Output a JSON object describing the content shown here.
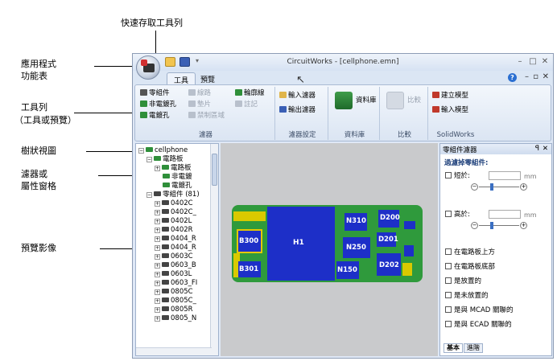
{
  "annotations": {
    "qat": "快速存取工具列",
    "app_menu_line1": "應用程式",
    "app_menu_line2": "功能表",
    "toolbar_line1": "工具列",
    "toolbar_line2": "（工具或預覽）",
    "tree_view": "樹狀視圖",
    "filter_line1": "濾器或",
    "filter_line2": "屬性窗格",
    "preview_image": "預覽影像"
  },
  "window": {
    "title": "CircuitWorks - [cellphone.emn]",
    "controls": [
      "–",
      "□",
      "✕"
    ]
  },
  "tabs": [
    "工具",
    "預覽"
  ],
  "ribbon": {
    "filters": {
      "items": [
        "零組件",
        "非電鍍孔",
        "電鍍孔",
        "線路",
        "墊片",
        "禁制區域",
        "輪廓線",
        "註記"
      ],
      "label": "濾器"
    },
    "filter_settings": {
      "items": [
        "輸入濾器",
        "輸出濾器"
      ],
      "label": "濾器設定"
    },
    "library": {
      "button": "資料庫",
      "label": "資料庫"
    },
    "compare": {
      "button": "比較",
      "label": "比較"
    },
    "solidworks": {
      "items": [
        "建立模型",
        "輸入模型"
      ],
      "label": "SolidWorks"
    }
  },
  "tree": {
    "root": "cellphone",
    "board": "電路板",
    "board_children": [
      "電路板",
      "非電鍍",
      "電鍍孔"
    ],
    "components": "零組件 (81)",
    "component_items": [
      "0402C",
      "0402C_",
      "0402L",
      "0402R",
      "0404_R",
      "0404_R",
      "0603C",
      "0603_B",
      "0603L",
      "0603_FI",
      "0805C",
      "0805C_",
      "0805R",
      "0805_N"
    ]
  },
  "pcb_labels": [
    "H1",
    "B300",
    "B301",
    "N310",
    "D200",
    "D201",
    "N250",
    "N150",
    "D202"
  ],
  "props": {
    "title": "零組件濾器",
    "filter_heading": "過濾掉零組件:",
    "short_label": "短於:",
    "tall_label": "高於:",
    "unit": "mm",
    "checkboxes": [
      "在電路板上方",
      "在電路板底部",
      "是放置的",
      "是未放置的",
      "是與 MCAD 關聯的",
      "是與 ECAD 關聯的"
    ],
    "tabs": [
      "基本",
      "進階"
    ]
  },
  "colors": {
    "pcb_green": "#2f9a3c",
    "component_blue": "#1d2fc8",
    "gold": "#d9c900"
  }
}
